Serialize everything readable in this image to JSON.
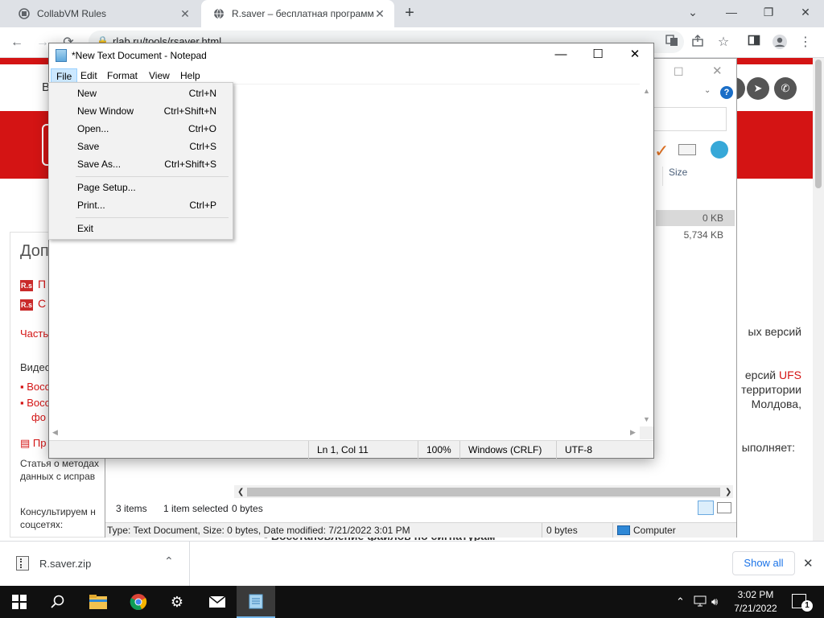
{
  "browser": {
    "tabs": [
      {
        "title": "CollabVM Rules"
      },
      {
        "title": "R.saver – бесплатная программа"
      }
    ],
    "new_tab": "+",
    "window_controls": {
      "minimize": "⌄",
      "restore_down": "—",
      "maximize": "❐",
      "close": "✕"
    },
    "url": "rlab.ru/tools/rsaver.html",
    "nav": {
      "back": "←",
      "forward": "→",
      "reload": "⟳"
    }
  },
  "webpage": {
    "heading_partial": "Доп",
    "top_partial": "В",
    "sidebar_links": [
      {
        "badge": "R.s",
        "text": "П"
      },
      {
        "badge": "R.s",
        "text": "С"
      }
    ],
    "left_texts": {
      "chast": "Часть",
      "video": "Видео",
      "bullet1": "Восс",
      "bullet2": "Восс",
      "bullet2b": "фо",
      "pr": "Пр",
      "article": "Статья о методах",
      "article2": "данных с исправ",
      "consult": "Консультируем н",
      "social": "соцсетях:"
    },
    "right_texts": {
      "line1": "ых версий",
      "line2_pre": "ерсий",
      "line2_link": "UFS",
      "line3": "территории",
      "line4": "Молдова,",
      "line5": "ыполняет:",
      "bottom": "Восстановление файлов по сигнатурам"
    }
  },
  "explorer": {
    "col_size": "Size",
    "sizes": [
      "0 KB",
      "5,734 KB"
    ],
    "status": {
      "items": "3 items",
      "selected": "1 item selected",
      "bytes": "0 bytes"
    },
    "details_bar": {
      "type_info": "Type: Text Document, Size: 0 bytes, Date modified: 7/21/2022 3:01 PM",
      "size": "0 bytes",
      "location": "Computer"
    }
  },
  "notepad": {
    "title": "*New Text Document - Notepad",
    "menus": [
      "File",
      "Edit",
      "Format",
      "View",
      "Help"
    ],
    "status": {
      "position": "Ln 1, Col 11",
      "zoom": "100%",
      "line_ending": "Windows (CRLF)",
      "encoding": "UTF-8"
    },
    "file_menu": [
      {
        "label": "New",
        "shortcut": "Ctrl+N"
      },
      {
        "label": "New Window",
        "shortcut": "Ctrl+Shift+N"
      },
      {
        "label": "Open...",
        "shortcut": "Ctrl+O"
      },
      {
        "label": "Save",
        "shortcut": "Ctrl+S"
      },
      {
        "label": "Save As...",
        "shortcut": "Ctrl+Shift+S"
      },
      {
        "label": "Page Setup...",
        "shortcut": ""
      },
      {
        "label": "Print...",
        "shortcut": "Ctrl+P"
      },
      {
        "label": "Exit",
        "shortcut": ""
      }
    ]
  },
  "download": {
    "file": "R.saver.zip",
    "show_all": "Show all"
  },
  "taskbar": {
    "time": "3:02 PM",
    "date": "7/21/2022",
    "notifications": "1"
  },
  "colors": {
    "accent_red": "#d41414",
    "menu_highlight": "#cce8ff",
    "link_blue": "#1a73e8"
  }
}
